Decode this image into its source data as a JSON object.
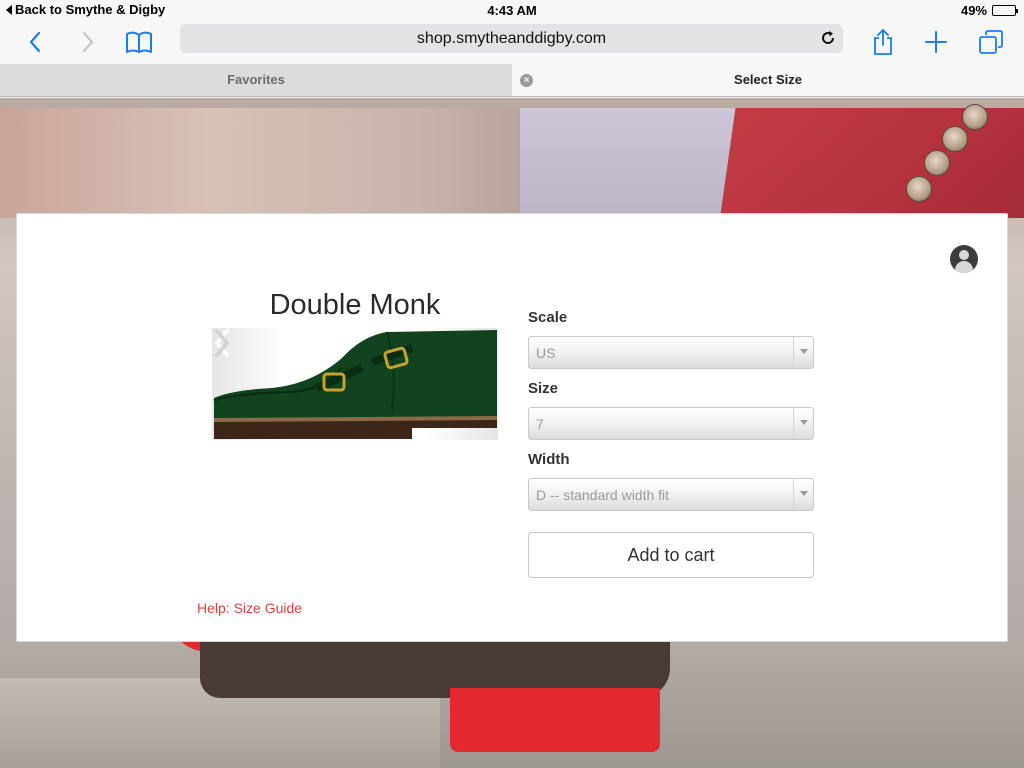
{
  "status_bar": {
    "back_label": "Back to Smythe & Digby",
    "time": "4:43 AM",
    "battery_percent": "49%",
    "battery_level": 0.49
  },
  "toolbar": {
    "url": "shop.smytheanddigby.com",
    "icons": {
      "back": "chevron-left-icon",
      "forward": "chevron-right-icon",
      "bookmarks": "book-icon",
      "reload": "reload-icon",
      "share": "share-icon",
      "new_tab": "plus-icon",
      "tabs": "tabs-icon"
    },
    "accent_color": "#1a7cf5"
  },
  "tabs": [
    {
      "label": "Favorites",
      "active": false
    },
    {
      "label": "Select Size",
      "active": true
    }
  ],
  "product": {
    "title": "Double Monk",
    "image_icon": "green-monk-shoe-image"
  },
  "form": {
    "scale": {
      "label": "Scale",
      "value": "US"
    },
    "size": {
      "label": "Size",
      "value": "7"
    },
    "width": {
      "label": "Width",
      "value": "D -- standard width fit"
    },
    "add_to_cart": "Add to cart"
  },
  "help_link": "Help: Size Guide",
  "colors": {
    "link_red": "#e0403a",
    "text_dark": "#2b2b2b"
  }
}
